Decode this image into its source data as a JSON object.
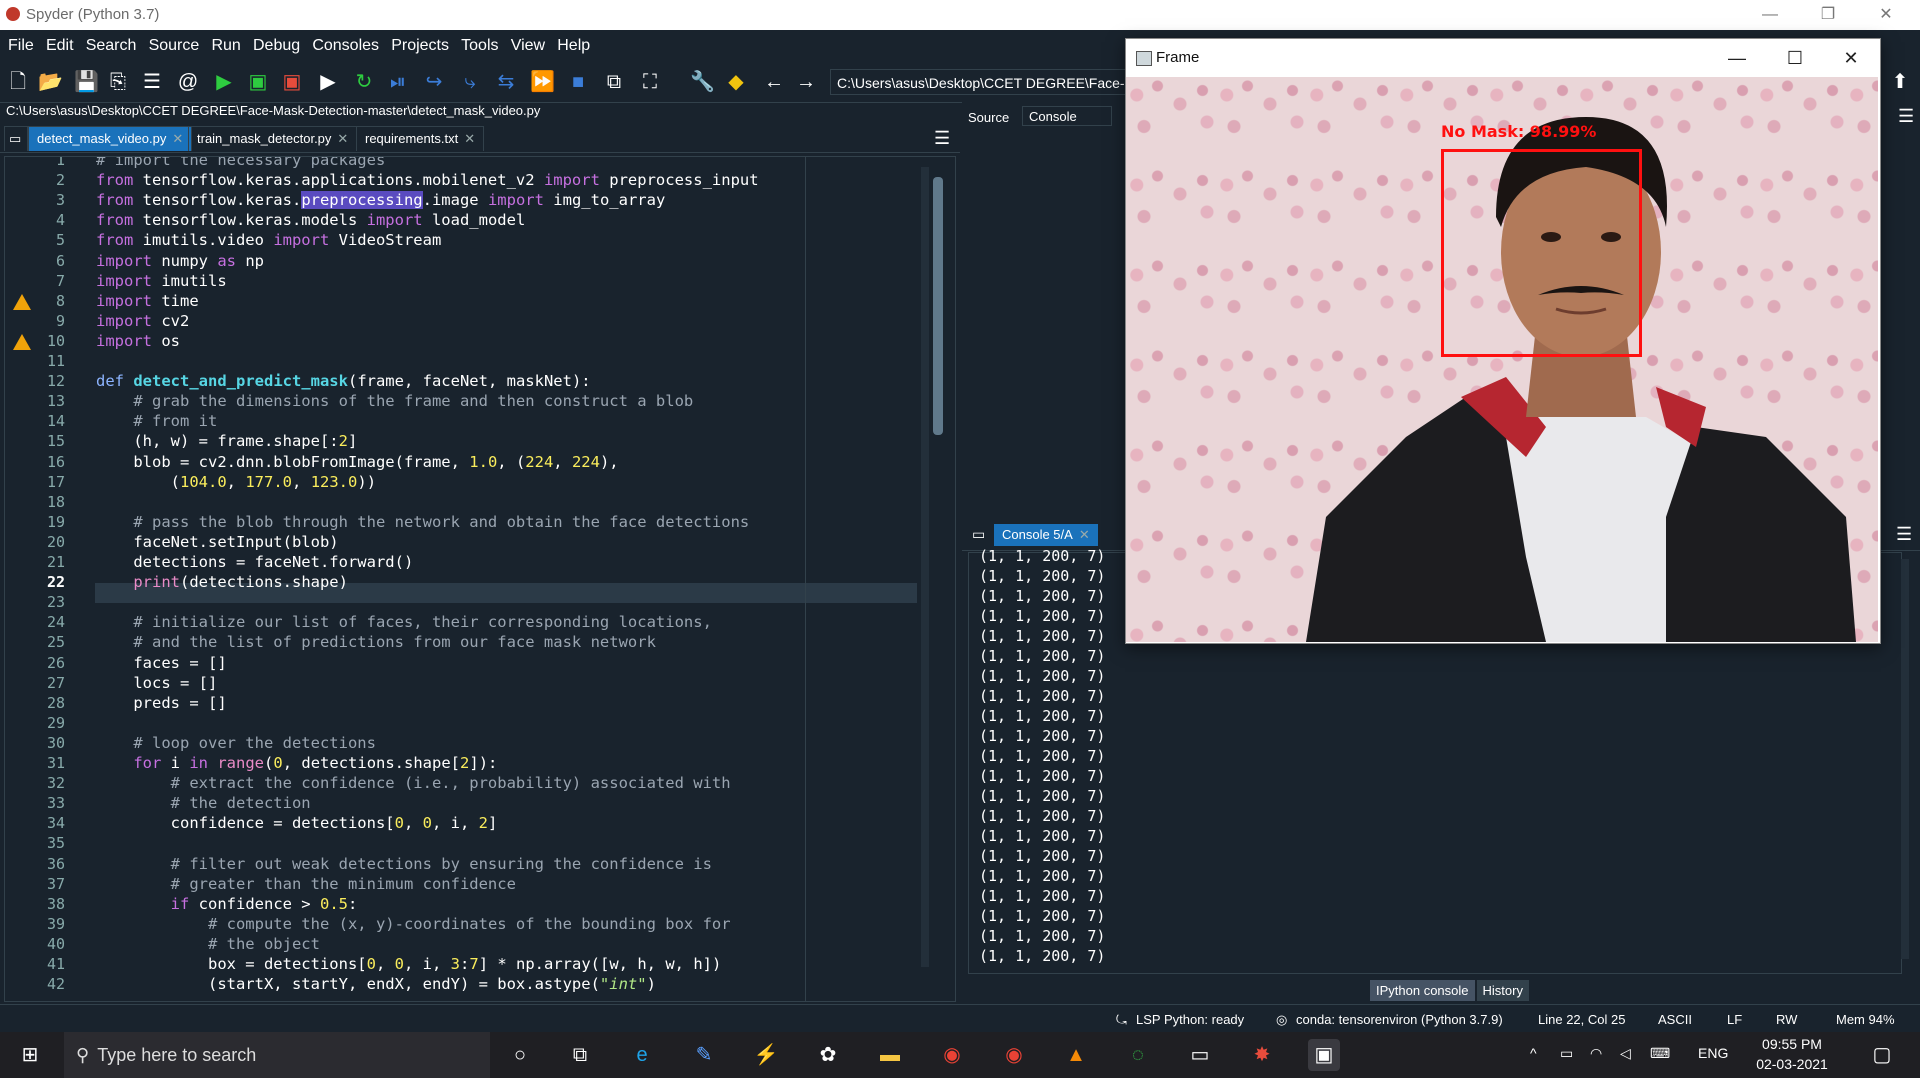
{
  "window": {
    "title": "Spyder (Python 3.7)",
    "min": "—",
    "max": "❐",
    "close": "✕"
  },
  "menu": [
    "File",
    "Edit",
    "Search",
    "Source",
    "Run",
    "Debug",
    "Consoles",
    "Projects",
    "Tools",
    "View",
    "Help"
  ],
  "toolbar": {
    "path": "C:\\Users\\asus\\Desktop\\CCET DEGREE\\Face-Mask-"
  },
  "editor": {
    "filepath": "C:\\Users\\asus\\Desktop\\CCET DEGREE\\Face-Mask-Detection-master\\detect_mask_video.py",
    "tabs": [
      {
        "label": "detect_mask_video.py",
        "active": true
      },
      {
        "label": "train_mask_detector.py",
        "active": false
      },
      {
        "label": "requirements.txt",
        "active": false
      }
    ],
    "current_line": 22,
    "warning_lines": [
      8,
      10
    ],
    "lines": [
      "# import the necessary packages",
      "from tensorflow.keras.applications.mobilenet_v2 import preprocess_input",
      "from tensorflow.keras.preprocessing.image import img_to_array",
      "from tensorflow.keras.models import load_model",
      "from imutils.video import VideoStream",
      "import numpy as np",
      "import imutils",
      "import time",
      "import cv2",
      "import os",
      "",
      "def detect_and_predict_mask(frame, faceNet, maskNet):",
      "    # grab the dimensions of the frame and then construct a blob",
      "    # from it",
      "    (h, w) = frame.shape[:2]",
      "    blob = cv2.dnn.blobFromImage(frame, 1.0, (224, 224),",
      "        (104.0, 177.0, 123.0))",
      "",
      "    # pass the blob through the network and obtain the face detections",
      "    faceNet.setInput(blob)",
      "    detections = faceNet.forward()",
      "    print(detections.shape)",
      "",
      "    # initialize our list of faces, their corresponding locations,",
      "    # and the list of predictions from our face mask network",
      "    faces = []",
      "    locs = []",
      "    preds = []",
      "",
      "    # loop over the detections",
      "    for i in range(0, detections.shape[2]):",
      "        # extract the confidence (i.e., probability) associated with",
      "        # the detection",
      "        confidence = detections[0, 0, i, 2]",
      "",
      "        # filter out weak detections by ensuring the confidence is",
      "        # greater than the minimum confidence",
      "        if confidence > 0.5:",
      "            # compute the (x, y)-coordinates of the bounding box for",
      "            # the object",
      "            box = detections[0, 0, i, 3:7] * np.array([w, h, w, h])",
      "            (startX, startY, endX, endY) = box.astype(\"int\")"
    ]
  },
  "help_pane": {
    "source_label": "Source",
    "source_value": "Console"
  },
  "console": {
    "tab": "Console 5/A",
    "output_line": "(1, 1, 200, 7)",
    "output_count": 21,
    "bottom_tabs": [
      "IPython console",
      "History"
    ]
  },
  "status": {
    "lsp": "LSP Python: ready",
    "conda": "conda: tensorenviron (Python 3.7.9)",
    "position": "Line 22, Col 25",
    "encoding": "ASCII",
    "eol": "LF",
    "mode": "RW",
    "mem": "Mem 94%"
  },
  "frame_window": {
    "title": "Frame",
    "prediction_label": "No Mask: 98.99%",
    "box_color": "#ff1010"
  },
  "taskbar": {
    "search_placeholder": "Type here to search",
    "lang": "ENG",
    "time": "09:55 PM",
    "date": "02-03-2021"
  }
}
